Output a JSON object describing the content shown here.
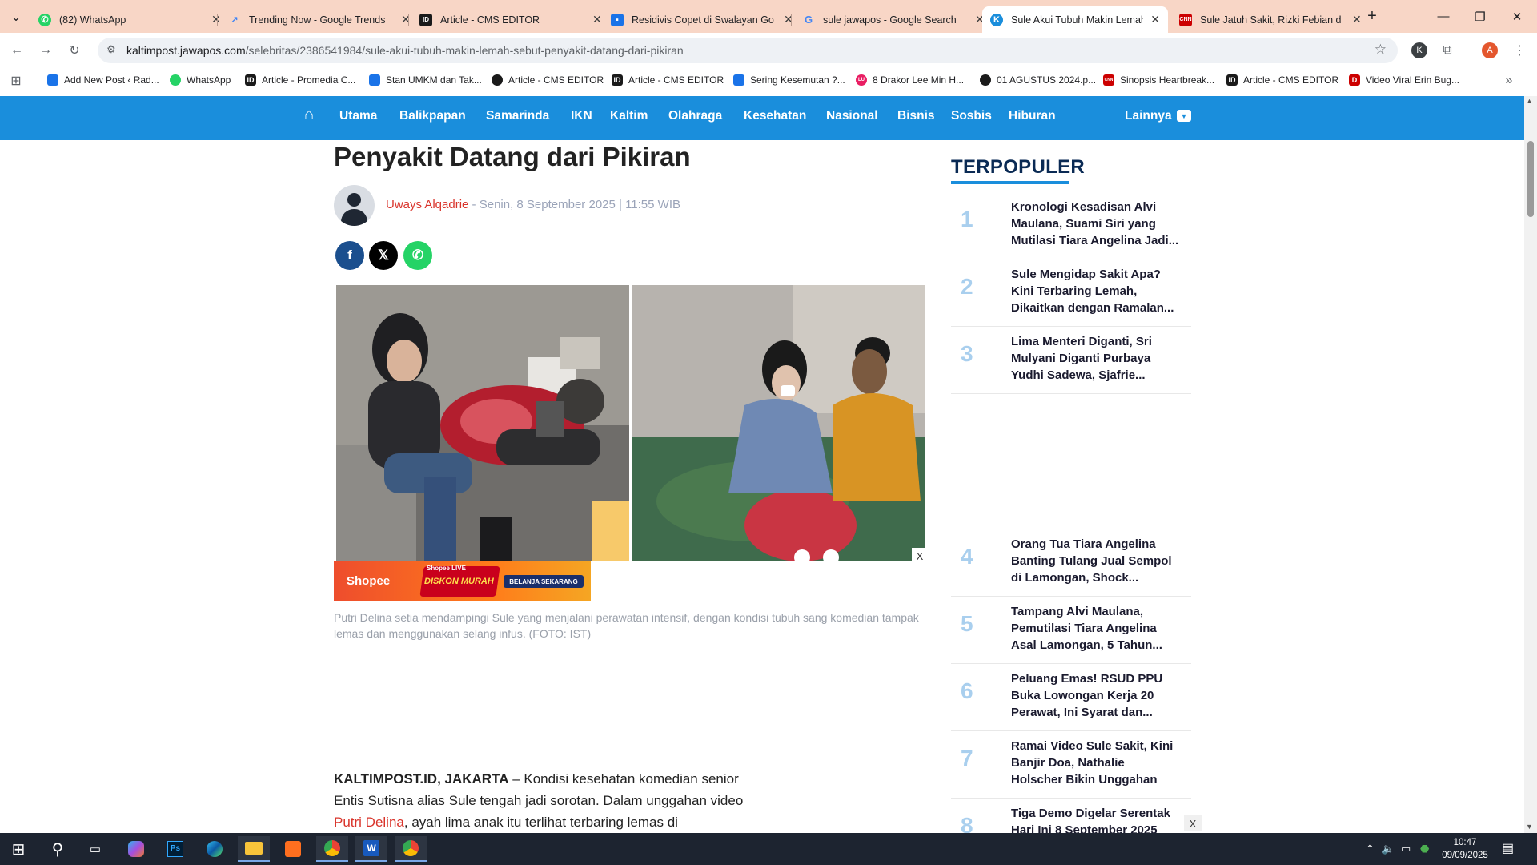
{
  "browser": {
    "tabs": [
      {
        "title": "(82) WhatsApp",
        "icon": "whatsapp-icon",
        "color": "#25d366"
      },
      {
        "title": "Trending Now - Google Trends",
        "icon": "trends-icon",
        "color": "#4285f4"
      },
      {
        "title": "Article - CMS EDITOR",
        "icon": "cms-icon",
        "color": "#1a1a1a"
      },
      {
        "title": "Residivis Copet di Swalayan Go",
        "icon": "doc-icon",
        "color": "#1a73e8"
      },
      {
        "title": "sule jawapos - Google Search",
        "icon": "google-icon",
        "color": "#4285f4"
      },
      {
        "title": "Sule Akui Tubuh Makin Lemah,",
        "icon": "kaltimpost-icon",
        "color": "#1a8edc"
      },
      {
        "title": "Sule Jatuh Sakit, Rizki Febian d",
        "icon": "news-icon",
        "color": "#cc0000"
      }
    ],
    "new_tab": "+",
    "url_host": "kaltimpost.jawapos.com",
    "url_path": "/selebritas/2386541984/sule-akui-tubuh-makin-lemah-sebut-penyakit-datang-dari-pikiran",
    "profile_letter": "A",
    "extension_letter": "K",
    "bookmarks": [
      {
        "label": "Add New Post ‹ Rad...",
        "color": "#1a73e8",
        "glyph": ""
      },
      {
        "label": "WhatsApp",
        "color": "#25d366",
        "glyph": ""
      },
      {
        "label": "Article - Promedia C...",
        "color": "#1a1a1a",
        "glyph": "ID"
      },
      {
        "label": "Stan UMKM dan Tak...",
        "color": "#1a73e8",
        "glyph": ""
      },
      {
        "label": "Article - CMS EDITOR",
        "color": "#1a1a1a",
        "glyph": ""
      },
      {
        "label": "Article - CMS EDITOR",
        "color": "#1a1a1a",
        "glyph": "ID"
      },
      {
        "label": "Sering Kesemutan ?...",
        "color": "#1a73e8",
        "glyph": ""
      },
      {
        "label": "8 Drakor Lee Min H...",
        "color": "#e91e63",
        "glyph": "LU"
      },
      {
        "label": "01 AGUSTUS 2024.p...",
        "color": "#1a1a1a",
        "glyph": ""
      },
      {
        "label": "Sinopsis Heartbreak...",
        "color": "#cc0000",
        "glyph": "CNN"
      },
      {
        "label": "Article - CMS EDITOR",
        "color": "#1a1a1a",
        "glyph": "ID"
      },
      {
        "label": "Video Viral Erin Bug...",
        "color": "#cc0000",
        "glyph": "D"
      }
    ]
  },
  "site": {
    "nav": [
      "Utama",
      "Balikpapan",
      "Samarinda",
      "IKN",
      "Kaltim",
      "Olahraga",
      "Kesehatan",
      "Nasional",
      "Bisnis",
      "Sosbis",
      "Hiburan"
    ],
    "more_label": "Lainnya"
  },
  "article": {
    "headline": "Penyakit Datang dari Pikiran",
    "author": "Uways Alqadrie",
    "date": " - Senin, 8 September 2025 | 11:55 WIB",
    "caption": "Putri Delina setia mendampingi Sule yang menjalani perawatan intensif, dengan kondisi tubuh sang komedian tampak lemas dan menggunakan selang infus. (FOTO: IST)",
    "lead": "KALTIMPOST.ID, JAKARTA",
    "body_1": " – Kondisi kesehatan komedian senior Entis Sutisna alias Sule tengah jadi sorotan. Dalam unggahan video ",
    "body_link": "Putri Delina",
    "body_2": ", ayah lima anak itu terlihat terbaring lemas di"
  },
  "ad": {
    "brand": "Shopee",
    "live": "Shopee LIVE",
    "promo": "DISKON MURAH",
    "cta": "BELANJA SEKARANG",
    "close": "X"
  },
  "sidebar": {
    "title": "TERPOPULER",
    "items": [
      {
        "n": "1",
        "text": "Kronologi Kesadisan Alvi Maulana, Suami Siri yang Mutilasi Tiara Angelina Jadi..."
      },
      {
        "n": "2",
        "text": "Sule Mengidap Sakit Apa? Kini Terbaring Lemah, Dikaitkan dengan Ramalan..."
      },
      {
        "n": "3",
        "text": "Lima Menteri Diganti, Sri Mulyani Diganti Purbaya Yudhi Sadewa, Sjafrie..."
      },
      {
        "n": "4",
        "text": "Orang Tua Tiara Angelina Banting Tulang Jual Sempol di Lamongan, Shock..."
      },
      {
        "n": "5",
        "text": "Tampang Alvi Maulana, Pemutilasi Tiara Angelina Asal Lamongan, 5 Tahun..."
      },
      {
        "n": "6",
        "text": "Peluang Emas! RSUD PPU Buka Lowongan Kerja 20 Perawat, Ini Syarat dan..."
      },
      {
        "n": "7",
        "text": "Ramai Video Sule Sakit, Kini Banjir Doa, Nathalie Holscher Bikin Unggahan yang Tuai..."
      },
      {
        "n": "8",
        "text": "Tiga Demo Digelar Serentak Hari Ini 8 September 2025"
      }
    ],
    "ad_close": "X"
  },
  "taskbar": {
    "time": "10:47",
    "date": "09/09/2025"
  }
}
